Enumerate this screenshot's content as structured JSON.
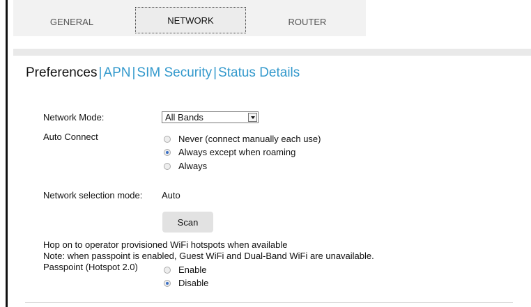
{
  "tabs": {
    "general": "GENERAL",
    "network": "NETWORK",
    "router": "ROUTER"
  },
  "subnav": {
    "preferences": "Preferences",
    "apn": "APN",
    "sim_security": "SIM Security",
    "status_details": "Status Details",
    "separator": "|"
  },
  "network_mode": {
    "label": "Network Mode:",
    "selected": "All Bands"
  },
  "auto_connect": {
    "label": "Auto Connect",
    "options": [
      "Never (connect manually each use)",
      "Always except when roaming",
      "Always"
    ],
    "selected_index": 1
  },
  "network_selection": {
    "label": "Network selection mode:",
    "value": "Auto",
    "scan_label": "Scan"
  },
  "hotspot": {
    "line1": "Hop on to operator provisioned WiFi hotspots when available",
    "line2": "Note: when passpoint is enabled, Guest WiFi and Dual-Band WiFi are unavailable.",
    "passpoint_label": "Passpoint (Hotspot 2.0)",
    "options": [
      "Enable",
      "Disable"
    ],
    "selected_index": 1
  }
}
